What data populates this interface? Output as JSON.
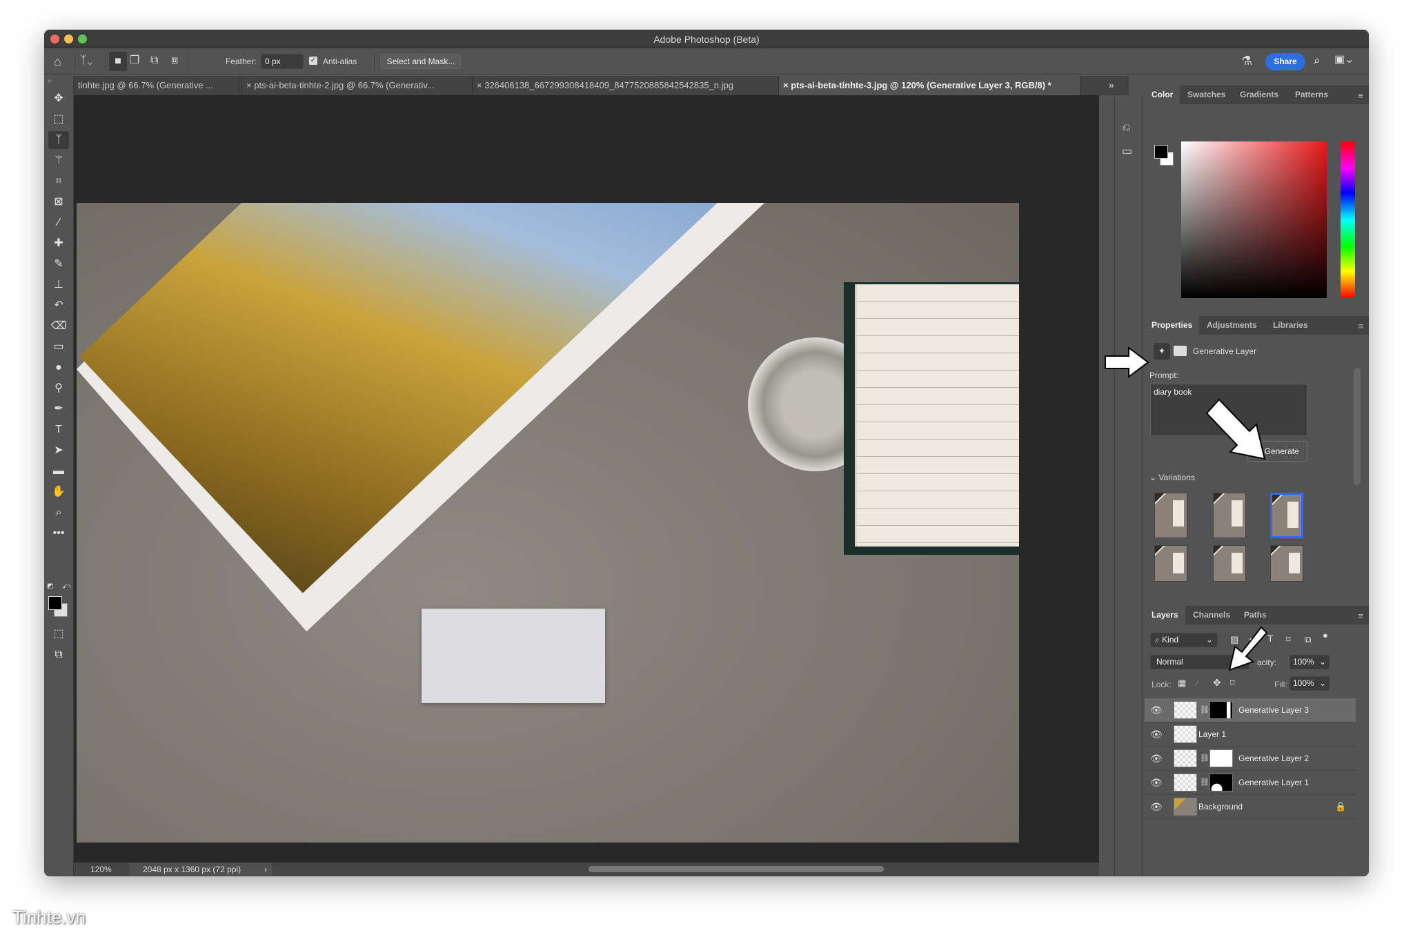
{
  "app": {
    "title": "Adobe Photoshop (Beta)"
  },
  "options_bar": {
    "feather_label": "Feather:",
    "feather_value": "0 px",
    "anti_alias_label": "Anti-alias",
    "anti_alias_checked": true,
    "select_and_mask_label": "Select and Mask...",
    "share_label": "Share"
  },
  "doc_tabs": [
    {
      "label": "tinhte.jpg @ 66.7% (Generative ..."
    },
    {
      "label": "pts-ai-beta-tinhte-2.jpg @ 66.7% (Generativ..."
    },
    {
      "label": "326406138_667299308418409_8477520885842542835_n.jpg"
    },
    {
      "label": "pts-ai-beta-tinhte-3.jpg @ 120% (Generative Layer 3, RGB/8) *",
      "active": true
    }
  ],
  "tools": [
    "move-icon",
    "marquee-icon",
    "lasso-icon",
    "magic-wand-icon",
    "crop-icon",
    "frame-icon",
    "eyedropper-icon",
    "healing-icon",
    "brush-icon",
    "stamp-icon",
    "history-brush-icon",
    "eraser-icon",
    "gradient-icon",
    "blur-icon",
    "dodge-icon",
    "pen-icon",
    "type-icon",
    "path-select-icon",
    "rectangle-icon",
    "hand-icon",
    "zoom-icon",
    "more-icon"
  ],
  "status": {
    "zoom": "120%",
    "doc_info": "2048 px x 1360 px (72 ppi)"
  },
  "color_panel": {
    "tabs": [
      "Color",
      "Swatches",
      "Gradients",
      "Patterns"
    ],
    "foreground": "#000000",
    "background": "#ffffff"
  },
  "properties": {
    "tabs": [
      "Properties",
      "Adjustments",
      "Libraries"
    ],
    "layer_type": "Generative Layer",
    "prompt_label": "Prompt:",
    "prompt_value": "diary book",
    "generate_label": "Generate",
    "variations_label": "Variations",
    "selected_variation": 3,
    "variation_count": 6
  },
  "layers_panel": {
    "tabs": [
      "Layers",
      "Channels",
      "Paths"
    ],
    "filter": "Kind",
    "blend_mode": "Normal",
    "opacity_label": "Opacity:",
    "opacity_visible": "acity:",
    "opacity": "100%",
    "lock_label": "Lock:",
    "fill_label": "Fill:",
    "fill": "100%",
    "layers": [
      {
        "name": "Generative Layer 3",
        "selected": true,
        "mask": "black-right-white"
      },
      {
        "name": "Layer 1"
      },
      {
        "name": "Generative Layer 2",
        "mask": "white"
      },
      {
        "name": "Generative Layer 1",
        "mask": "black-shape"
      },
      {
        "name": "Background",
        "locked": true
      }
    ]
  },
  "watermark": "Tinhte.vn",
  "colors": {
    "accent": "#2d6ee0",
    "panel": "#535353",
    "canvas": "#282828"
  }
}
